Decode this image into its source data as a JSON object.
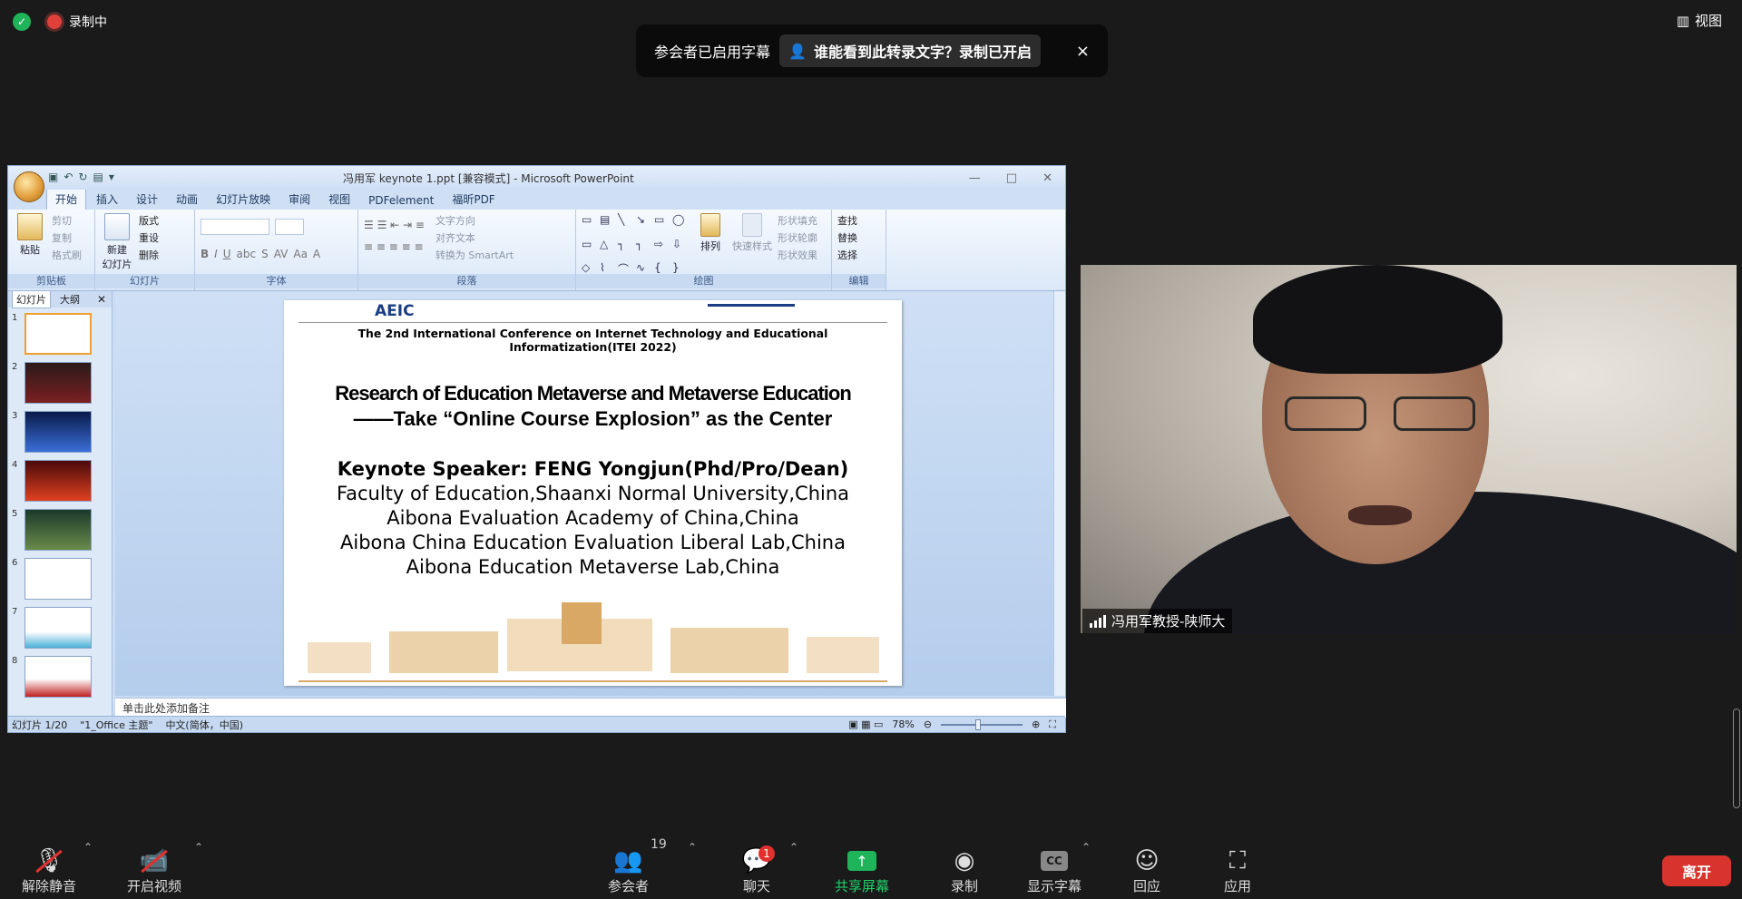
{
  "top": {
    "recording_label": "录制中",
    "view_label": "视图"
  },
  "caption_banner": {
    "text": "参会者已启用字幕",
    "link": "谁能看到此转录文字？录制已开启",
    "close": "×"
  },
  "ppt": {
    "window_title": "冯用军 keynote 1.ppt [兼容模式] - Microsoft PowerPoint",
    "tabs": [
      "开始",
      "插入",
      "设计",
      "动画",
      "幻灯片放映",
      "审阅",
      "视图",
      "PDFelement",
      "福昕PDF"
    ],
    "ribbon": {
      "paste": "粘贴",
      "cut": "剪切",
      "copy": "复制",
      "format_painter": "格式刷",
      "new_slide": "新建",
      "new_slide2": "幻灯片",
      "layout": "版式",
      "reset": "重设",
      "delete": "删除",
      "text_direction": "文字方向",
      "align_text": "对齐文本",
      "smartart": "转换为 SmartArt",
      "arrange": "排列",
      "quick_styles": "快速样式",
      "shape_fill": "形状填充",
      "shape_outline": "形状轮廓",
      "shape_effects": "形状效果",
      "find": "查找",
      "replace": "替换",
      "select": "选择",
      "groups": [
        "剪贴板",
        "幻灯片",
        "字体",
        "段落",
        "绘图",
        "编辑"
      ]
    },
    "pane_tabs": [
      "幻灯片",
      "大纲"
    ],
    "thumb_numbers": [
      "1",
      "2",
      "3",
      "4",
      "5",
      "6",
      "7",
      "8"
    ],
    "slide": {
      "logo_left": "AEIC",
      "conference": "The 2nd International Conference on Internet Technology and Educational Informatization(ITEI 2022)",
      "title1": "Research of Education Metaverse and Metaverse Education",
      "title2": "——Take “Online Course Explosion” as the Center",
      "speaker": "Keynote Speaker:  FENG Yongjun(Phd/Pro/Dean)",
      "affiliations": [
        "Faculty of Education,Shaanxi Normal University,China",
        "Aibona Evaluation Academy of China,China",
        "Aibona China Education Evaluation Liberal Lab,China",
        "Aibona Education Metaverse Lab,China"
      ]
    },
    "notes_placeholder": "单击此处添加备注",
    "status": {
      "slide_count": "幻灯片 1/20",
      "theme": "\"1_Office 主题\"",
      "language": "中文(简体，中国)",
      "zoom": "78%"
    }
  },
  "video": {
    "name": "冯用军教授-陕师大"
  },
  "toolbar": {
    "mute": "解除静音",
    "video": "开启视频",
    "participants": "参会者",
    "participants_count": "19",
    "chat": "聊天",
    "chat_badge": "1",
    "share": "共享屏幕",
    "record": "录制",
    "captions": "显示字幕",
    "captions_icon": "CC",
    "reactions": "回应",
    "apps": "应用",
    "leave": "离开"
  },
  "colors": {
    "share_green": "#1fb35a",
    "leave_red": "#d9332d",
    "recording_red": "#e0403a"
  }
}
